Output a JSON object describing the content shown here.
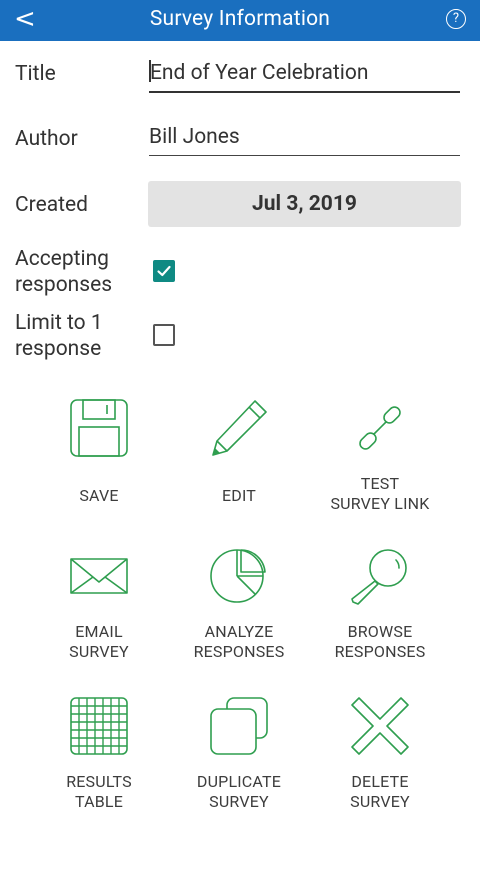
{
  "appbar": {
    "back": "<",
    "title": "Survey Information",
    "help": "?"
  },
  "form": {
    "title_label": "Title",
    "title_value": "End of Year Celebration",
    "author_label": "Author",
    "author_value": "Bill Jones",
    "created_label": "Created",
    "created_value": "Jul 3, 2019",
    "accepting_label_1": "Accepting",
    "accepting_label_2": "responses",
    "accepting_checked": true,
    "limit_label_1": "Limit to 1",
    "limit_label_2": "response",
    "limit_checked": false
  },
  "actions": {
    "save": [
      "SAVE"
    ],
    "edit": [
      "EDIT"
    ],
    "test": [
      "TEST",
      "SURVEY LINK"
    ],
    "email": [
      "EMAIL",
      "SURVEY"
    ],
    "analyze": [
      "ANALYZE",
      "RESPONSES"
    ],
    "browse": [
      "BROWSE",
      "RESPONSES"
    ],
    "results": [
      "RESULTS",
      "TABLE"
    ],
    "duplicate": [
      "DUPLICATE",
      "SURVEY"
    ],
    "delete": [
      "DELETE",
      "SURVEY"
    ]
  },
  "colors": {
    "appbar": "#1a6fbf",
    "icon_green": "#2f9e4f",
    "checkbox_teal": "#0f8a83"
  }
}
